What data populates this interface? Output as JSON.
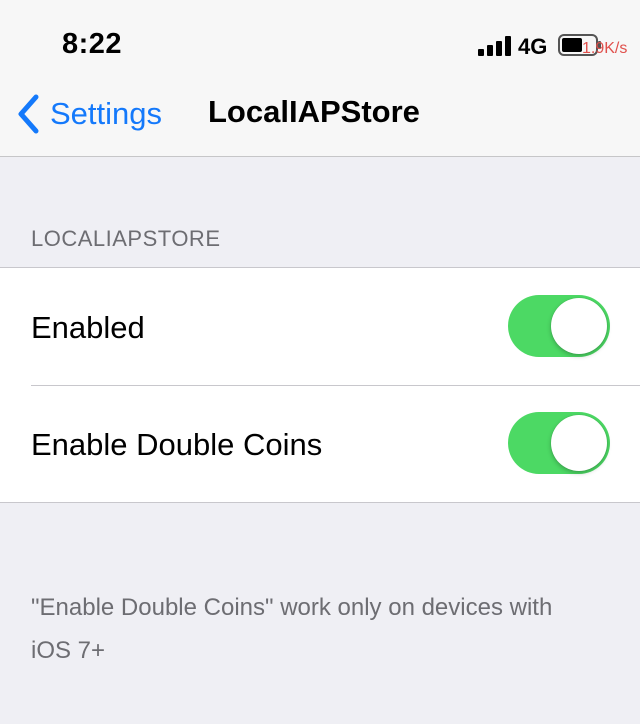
{
  "status_bar": {
    "time": "8:22",
    "network": "4G",
    "speed": "1.9K/s",
    "signal_icon": "cellular-signal-icon",
    "battery_icon": "battery-icon"
  },
  "nav": {
    "back_label": "Settings",
    "back_icon": "chevron-left-icon",
    "title": "LocalIAPStore"
  },
  "section": {
    "header": "LOCALIAPSTORE",
    "rows": [
      {
        "label": "Enabled",
        "toggle_on": true
      },
      {
        "label": "Enable Double Coins",
        "toggle_on": true
      }
    ],
    "footer": "\"Enable Double Coins\" work only on devices with iOS 7+"
  },
  "colors": {
    "accent": "#1479fb",
    "toggle_on": "#4cd964",
    "background": "#efeff4",
    "secondary_text": "#6d6d72",
    "speed_text": "#e0504c"
  }
}
